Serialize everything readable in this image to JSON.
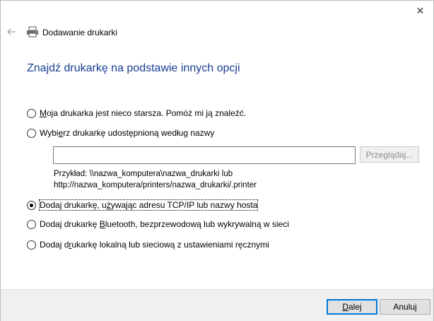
{
  "window": {
    "close_glyph": "✕",
    "header_title": "Dodawanie drukarki"
  },
  "page": {
    "title": "Znajdź drukarkę na podstawie innych opcji"
  },
  "options": [
    {
      "pre": "",
      "accel": "M",
      "post": "oja drukarka jest nieco starsza. Pomóż mi ją znaleźć.",
      "checked": false
    },
    {
      "pre": "Wybi",
      "accel": "e",
      "post": "rz drukarkę udostępnioną według nazwy",
      "checked": false
    },
    {
      "pre": "Dodaj drukarkę, u",
      "accel": "ż",
      "post": "ywając adresu TCP/IP lub nazwy hosta",
      "checked": true
    },
    {
      "pre": "Dodaj drukarkę ",
      "accel": "B",
      "post": "luetooth, bezprzewodową lub wykrywalną w sieci",
      "checked": false
    },
    {
      "pre": "Dodaj d",
      "accel": "r",
      "post": "ukarkę lokalną lub sieciową z ustawieniami ręcznymi",
      "checked": false
    }
  ],
  "shared_printer": {
    "input_value": "",
    "browse_label": "Przeglądaj...",
    "example_line1": "Przykład: \\\\nazwa_komputera\\nazwa_drukarki lub",
    "example_line2": "http://nazwa_komputera/printers/nazwa_drukarki/.printer"
  },
  "footer": {
    "next_accel": "D",
    "next_rest": "alej",
    "cancel_label": "Anuluj"
  },
  "colors": {
    "title_blue": "#1b3f94",
    "default_button_border": "#0078d7",
    "footer_bg": "#f0f0f0"
  }
}
